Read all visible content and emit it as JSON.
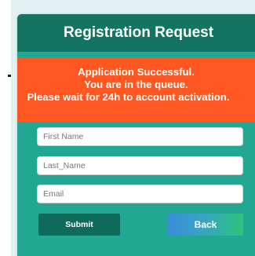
{
  "card": {
    "title": "Registration Request"
  },
  "alert": {
    "line1": "Application Successful.",
    "line2": "You are in the queue.",
    "line3": "Please wait for 24h to account activation."
  },
  "form": {
    "first_name_placeholder": "First Name",
    "last_name_placeholder": "Last_Name",
    "email_placeholder": "Email",
    "submit_label": "Submit",
    "back_label": "Back"
  },
  "colors": {
    "header": "#137462",
    "card": "#22a793",
    "alert": "#fe5722",
    "submit": "#0f6b59"
  }
}
